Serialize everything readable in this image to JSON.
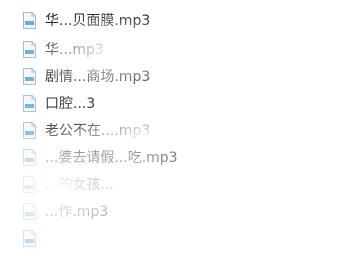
{
  "files": [
    {
      "name": "华...贝面膜.mp3",
      "icon": "audio-file-icon"
    },
    {
      "name": "华...mp3",
      "icon": "audio-file-icon"
    },
    {
      "name": "剧情...商场.mp3",
      "icon": "audio-file-icon"
    },
    {
      "name": "口腔...3",
      "icon": "audio-file-icon"
    },
    {
      "name": "老公不在....mp3",
      "icon": "audio-file-icon"
    },
    {
      "name": "...婆去请假...吃.mp3",
      "icon": "audio-file-icon"
    },
    {
      "name": "...的女孩...",
      "icon": "audio-file-icon"
    },
    {
      "name": "...作.mp3",
      "icon": "audio-file-icon"
    },
    {
      "name": "",
      "icon": "audio-file-icon"
    }
  ],
  "colors": {
    "text": "#1a1a1a",
    "icon_border": "#9fb7c9",
    "icon_fill": "#f2f7fb",
    "icon_accent": "#2b8fd0"
  }
}
